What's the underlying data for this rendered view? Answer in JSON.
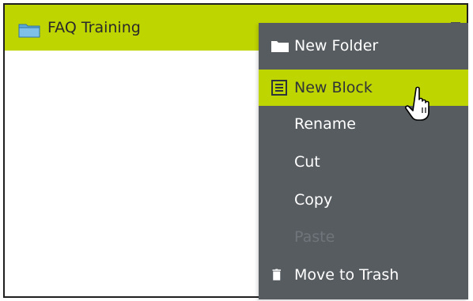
{
  "header": {
    "title": "FAQ Training",
    "icon": "folder-icon",
    "menu_icon": "hamburger-icon",
    "background_color": "#bfd500"
  },
  "context_menu": {
    "background_color": "#575c61",
    "highlight_color": "#bfd500",
    "items": [
      {
        "label": "New Folder",
        "icon": "folder-icon",
        "state": "normal"
      },
      {
        "label": "New Block",
        "icon": "list-icon",
        "state": "highlighted"
      },
      {
        "label": "Rename",
        "icon": "",
        "state": "normal"
      },
      {
        "label": "Cut",
        "icon": "",
        "state": "normal"
      },
      {
        "label": "Copy",
        "icon": "",
        "state": "normal"
      },
      {
        "label": "Paste",
        "icon": "",
        "state": "disabled"
      },
      {
        "label": "Move to Trash",
        "icon": "trash-icon",
        "state": "normal"
      }
    ]
  },
  "cursor": {
    "icon": "hand-pointer-icon"
  }
}
